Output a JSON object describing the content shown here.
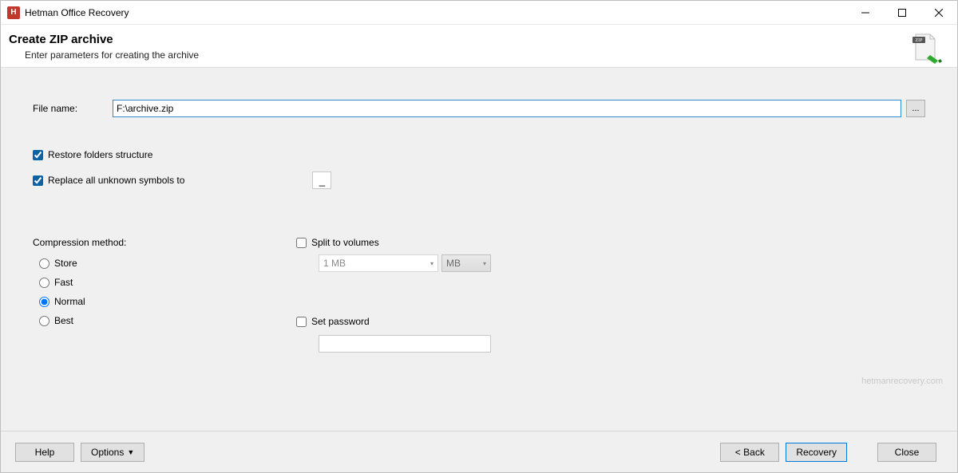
{
  "titlebar": {
    "app_icon_letter": "H",
    "title": "Hetman Office Recovery"
  },
  "header": {
    "title": "Create ZIP archive",
    "subtitle": "Enter parameters for creating the archive",
    "zip_badge": "ZIP"
  },
  "file": {
    "label": "File name:",
    "value": "F:\\archive.zip",
    "browse": "..."
  },
  "options": {
    "restore_label": "Restore folders structure",
    "restore_checked": true,
    "replace_label": "Replace all unknown symbols to",
    "replace_checked": true,
    "replace_char": "_"
  },
  "compression": {
    "title": "Compression method:",
    "choices": {
      "store": "Store",
      "fast": "Fast",
      "normal": "Normal",
      "best": "Best"
    },
    "selected": "normal"
  },
  "split": {
    "label": "Split to volumes",
    "checked": false,
    "size_value": "1 MB",
    "unit_value": "MB"
  },
  "password": {
    "label": "Set password",
    "checked": false,
    "value": ""
  },
  "footer": {
    "help": "Help",
    "options": "Options",
    "back": "< Back",
    "recovery": "Recovery",
    "close": "Close"
  },
  "watermark": "hetmanrecovery.com"
}
